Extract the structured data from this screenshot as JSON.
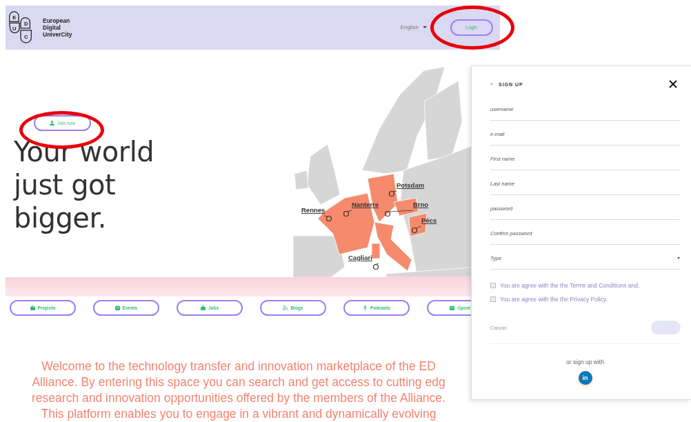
{
  "header": {
    "logo_letters": [
      "E",
      "D",
      "U",
      "C"
    ],
    "logo_name": [
      "European",
      "Digital",
      "UniverCity"
    ],
    "language": "English",
    "login": "Login"
  },
  "hero": {
    "join_button": "Join now",
    "headline": [
      "Your world",
      "just got",
      "bigger."
    ],
    "cities": [
      {
        "name": "Rennes"
      },
      {
        "name": "Nanterre"
      },
      {
        "name": "Potsdam"
      },
      {
        "name": "Brno"
      },
      {
        "name": "Pécs"
      },
      {
        "name": "Cagliari"
      }
    ]
  },
  "nav": [
    {
      "label": "Projects"
    },
    {
      "label": "Events"
    },
    {
      "label": "Jobs"
    },
    {
      "label": "Blogs"
    },
    {
      "label": "Podcasts"
    },
    {
      "label": "Openi"
    }
  ],
  "welcome": [
    "Welcome to the technology transfer and innovation marketplace of the ED",
    "Alliance. By entering this space you can search and get access to cutting edg",
    "research and innovation opportunities offered by the members of the Alliance.",
    "This platform enables you to engage in a vibrant and dynamically evolving"
  ],
  "signup": {
    "title": "SIGN UP",
    "fields": [
      {
        "placeholder": "username",
        "kind": "text"
      },
      {
        "placeholder": "e-mail",
        "kind": "text"
      },
      {
        "placeholder": "First name",
        "kind": "text"
      },
      {
        "placeholder": "Last name",
        "kind": "text"
      },
      {
        "placeholder": "password",
        "kind": "text"
      },
      {
        "placeholder": "Confirm password",
        "kind": "text"
      },
      {
        "placeholder": "Type",
        "kind": "select"
      }
    ],
    "checkboxes": [
      {
        "label": "You are agree with the the Terms and Conditions and.",
        "checked": false
      },
      {
        "label": "You are agree with the the Privacy Policy.",
        "checked": false
      }
    ],
    "cancel": "Cancel",
    "alt_label": "or sign up with",
    "social": "in"
  }
}
